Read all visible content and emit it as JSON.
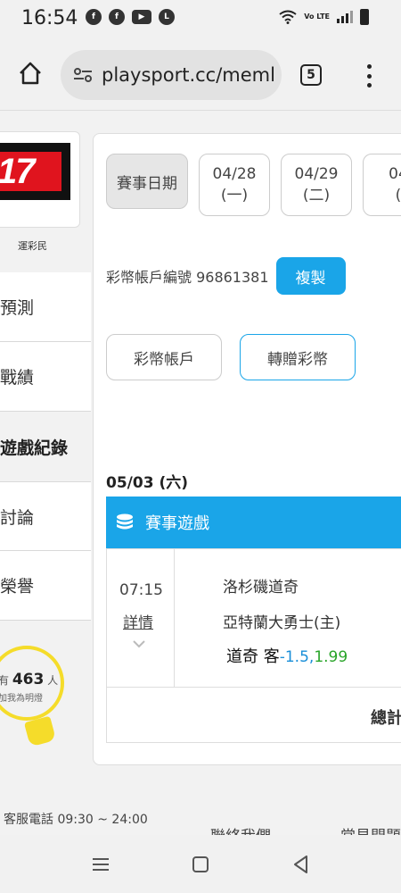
{
  "status_bar": {
    "time": "16:54",
    "apps": [
      "facebook-icon",
      "facebook-icon",
      "youtube-icon",
      "line-icon"
    ],
    "network_label": "Vo LTE"
  },
  "browser": {
    "url": "playsport.cc/meml",
    "tab_count": "5"
  },
  "sidebar": {
    "logo_text": "17",
    "caption": "運彩民",
    "items": [
      {
        "label": "預測"
      },
      {
        "label": "戰績"
      },
      {
        "label": "遊戲紀錄"
      },
      {
        "label": "討論"
      },
      {
        "label": "榮譽"
      }
    ],
    "active_item": "遊戲紀錄",
    "fans": {
      "prefix": "有",
      "count": "463",
      "suffix": "人",
      "sub": "加我為明燈"
    }
  },
  "main": {
    "date_label": "賽事日期",
    "dates": [
      {
        "date": "04/28",
        "weekday": "(一)"
      },
      {
        "date": "04/29",
        "weekday": "(二)"
      },
      {
        "date": "04",
        "weekday": "("
      }
    ],
    "account_label": "彩幣帳戶編號 96861381",
    "copy_label": "複製",
    "buttons": {
      "account": "彩幣帳戶",
      "transfer": "轉贈彩幣"
    },
    "day_heading": "05/03 (六)",
    "section_title": "賽事遊戲",
    "game": {
      "time": "07:15",
      "detail_label": "詳情",
      "away_team": "洛杉磯道奇",
      "home_team": "亞特蘭大勇士(主)",
      "pick_team": "道奇 客",
      "pick_line": "-1.5,",
      "pick_odds": "1.99"
    },
    "total_label": "總計"
  },
  "footer": {
    "customer_service": "客服電話 09:30 ~ 24:00",
    "contact": "聯絡我們",
    "faq": "常見問題"
  },
  "colors": {
    "accent": "#1aa5e8",
    "logo_red": "#e0141e",
    "bulb_yellow": "#f5dc2a",
    "odds_green": "#2aa52a"
  }
}
